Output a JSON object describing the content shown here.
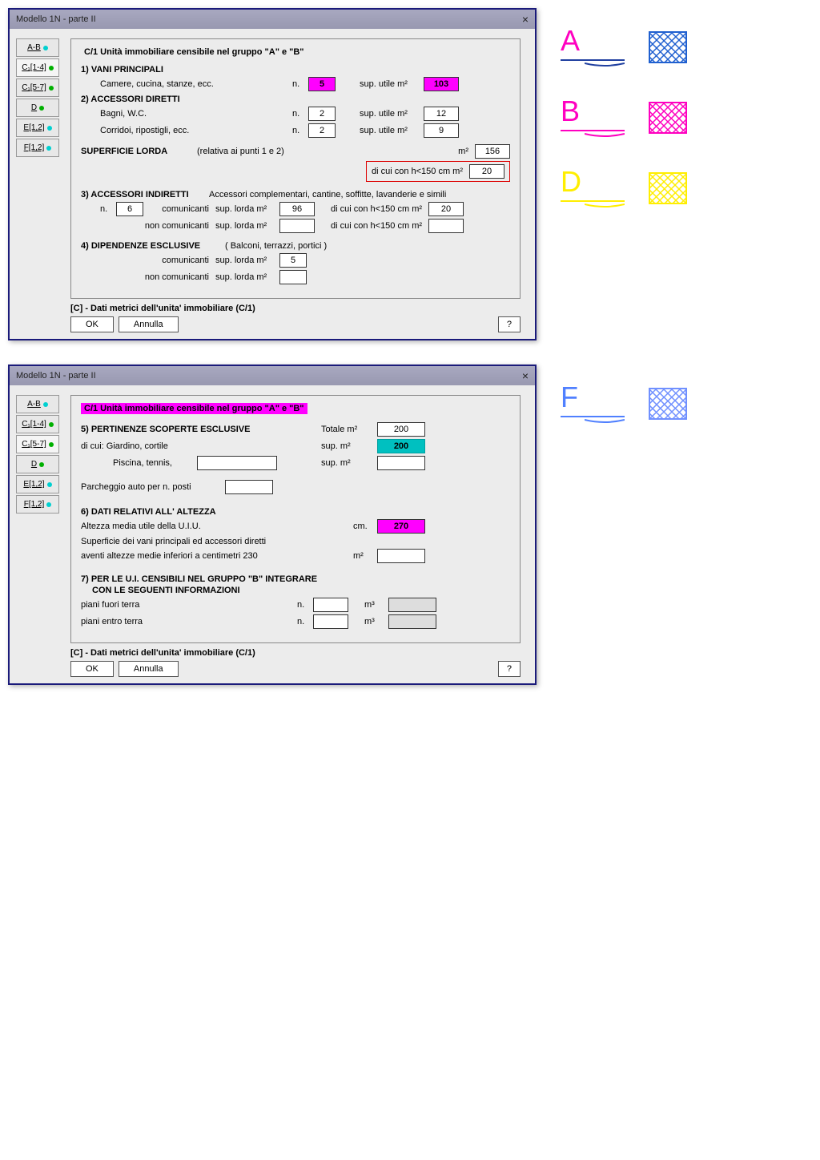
{
  "window": {
    "title": "Modello 1N  -   parte II",
    "close": "×"
  },
  "tabs": {
    "ab": "A-B",
    "c114": "C₁[1-4]",
    "c157": "C₁[5-7]",
    "d": "D",
    "e12": "E[1,2]",
    "f12": "F[1,2]"
  },
  "top": {
    "legend": "C/1  Unità immobiliare censibile nel gruppo \"A\" e \"B\"",
    "s1": "1) VANI PRINCIPALI",
    "s1a": "Camere, cucina, stanze, ecc.",
    "s2": "2) ACCESSORI DIRETTI",
    "s2a": "Bagni, W.C.",
    "s2b": "Corridoi, ripostigli, ecc.",
    "s2c": "SUPERFICIE LORDA",
    "s2c_note": "(relativa ai punti 1 e 2)",
    "s3": "3) ACCESSORI INDIRETTI",
    "s3_note": "Accessori complementari, cantine, soffitte, lavanderie e simili",
    "s3a": "comunicanti",
    "s3b": "non comunicanti",
    "s4": "4) DIPENDENZE ESCLUSIVE",
    "s4_note": "( Balconi, terrazzi, portici )",
    "n_lbl": "n.",
    "sup_utile": "sup. utile  m²",
    "sup_lorda": "sup. lorda m²",
    "m2": "m²",
    "h150": "di cui con h<150 cm  m²",
    "v_s1_n": "5",
    "v_s1_sup": "103",
    "v_s2a_n": "2",
    "v_s2a_sup": "12",
    "v_s2b_n": "2",
    "v_s2b_sup": "9",
    "v_lorda": "156",
    "v_h150_a": "20",
    "v_s3_n": "6",
    "v_s3_com": "96",
    "v_s3_h150": "20"
  },
  "bottom": {
    "legend": "C/1  Unità immobiliare censibile nel gruppo \"A\" e \"B\"",
    "s5": "5) PERTINENZE SCOPERTE ESCLUSIVE",
    "s5a": "di cui:  Giardino, cortile",
    "s5b": "Piscina, tennis,",
    "s5c": "Parcheggio auto per n. posti",
    "tot": "Totale m²",
    "sup": "sup. m²",
    "v_tot": "200",
    "v_giard": "200",
    "s6": "6) DATI RELATIVI ALL' ALTEZZA",
    "s6a": "Altezza media utile della U.I.U.",
    "s6b": "Superficie dei vani principali ed accessori diretti",
    "s6c": "aventi altezze medie inferiori a centimetri 230",
    "cm": "cm.",
    "v_cm": "270",
    "s7": "7) PER LE U.I. CENSIBILI NEL GRUPPO \"B\" INTEGRARE",
    "s7b": "CON LE SEGUENTI INFORMAZIONI",
    "s7c": "piani fuori terra",
    "s7d": "piani entro terra",
    "m3": "m³"
  },
  "footer": {
    "caption": "[C] - Dati metrici dell'unita' immobiliare (C/1)",
    "ok": "OK",
    "cancel": "Annulla",
    "help": "?"
  },
  "legend_letters": {
    "a": "A",
    "b": "B",
    "d": "D",
    "f": "F"
  }
}
